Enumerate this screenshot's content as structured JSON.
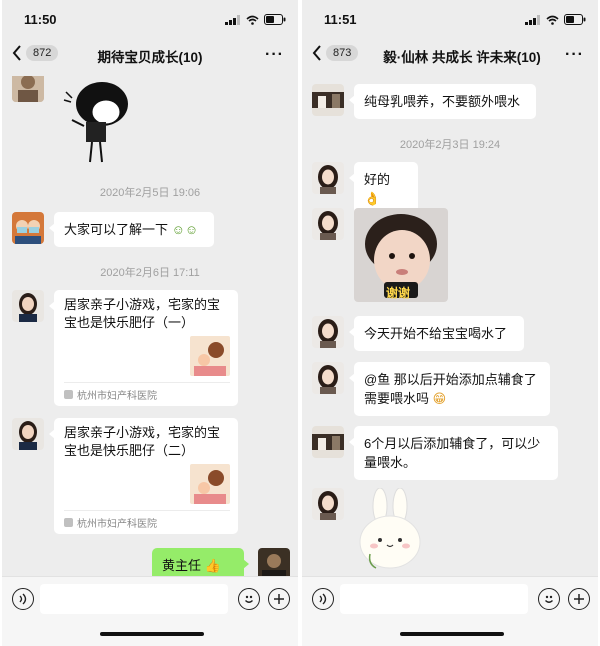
{
  "left": {
    "status": {
      "time": "11:50"
    },
    "nav": {
      "back_count": "872",
      "title": "期待宝贝成长(10)",
      "more": "···"
    },
    "messages": {
      "ts1": "2020年2月5日 19:06",
      "msg1": "大家可以了解一下",
      "ts2": "2020年2月6日 17:11",
      "card1_title": "居家亲子小游戏，宅家的宝宝也是快乐肥仔（一）",
      "card1_source": "杭州市妇产科医院",
      "card2_title": "居家亲子小游戏，宅家的宝宝也是快乐肥仔（二）",
      "card2_source": "杭州市妇产科医院",
      "self_msg": "黄主任"
    }
  },
  "right": {
    "status": {
      "time": "11:51"
    },
    "nav": {
      "back_count": "873",
      "title": "毅·仙林  共成长  许未来(10)",
      "more": "···"
    },
    "messages": {
      "msg1": "纯母乳喂养，不要额外喂水",
      "ts1": "2020年2月3日 19:24",
      "msg2": "好的",
      "sticker_text": "谢谢",
      "msg3": "今天开始不给宝宝喝水了",
      "msg4": "@鱼 那以后开始添加点辅食了需要喂水吗",
      "msg5": "6个月以后添加辅食了，可以少量喂水。"
    }
  },
  "colors": {
    "chat_bg": "#ededed",
    "self_bubble": "#95ec69",
    "bubble": "#ffffff"
  }
}
